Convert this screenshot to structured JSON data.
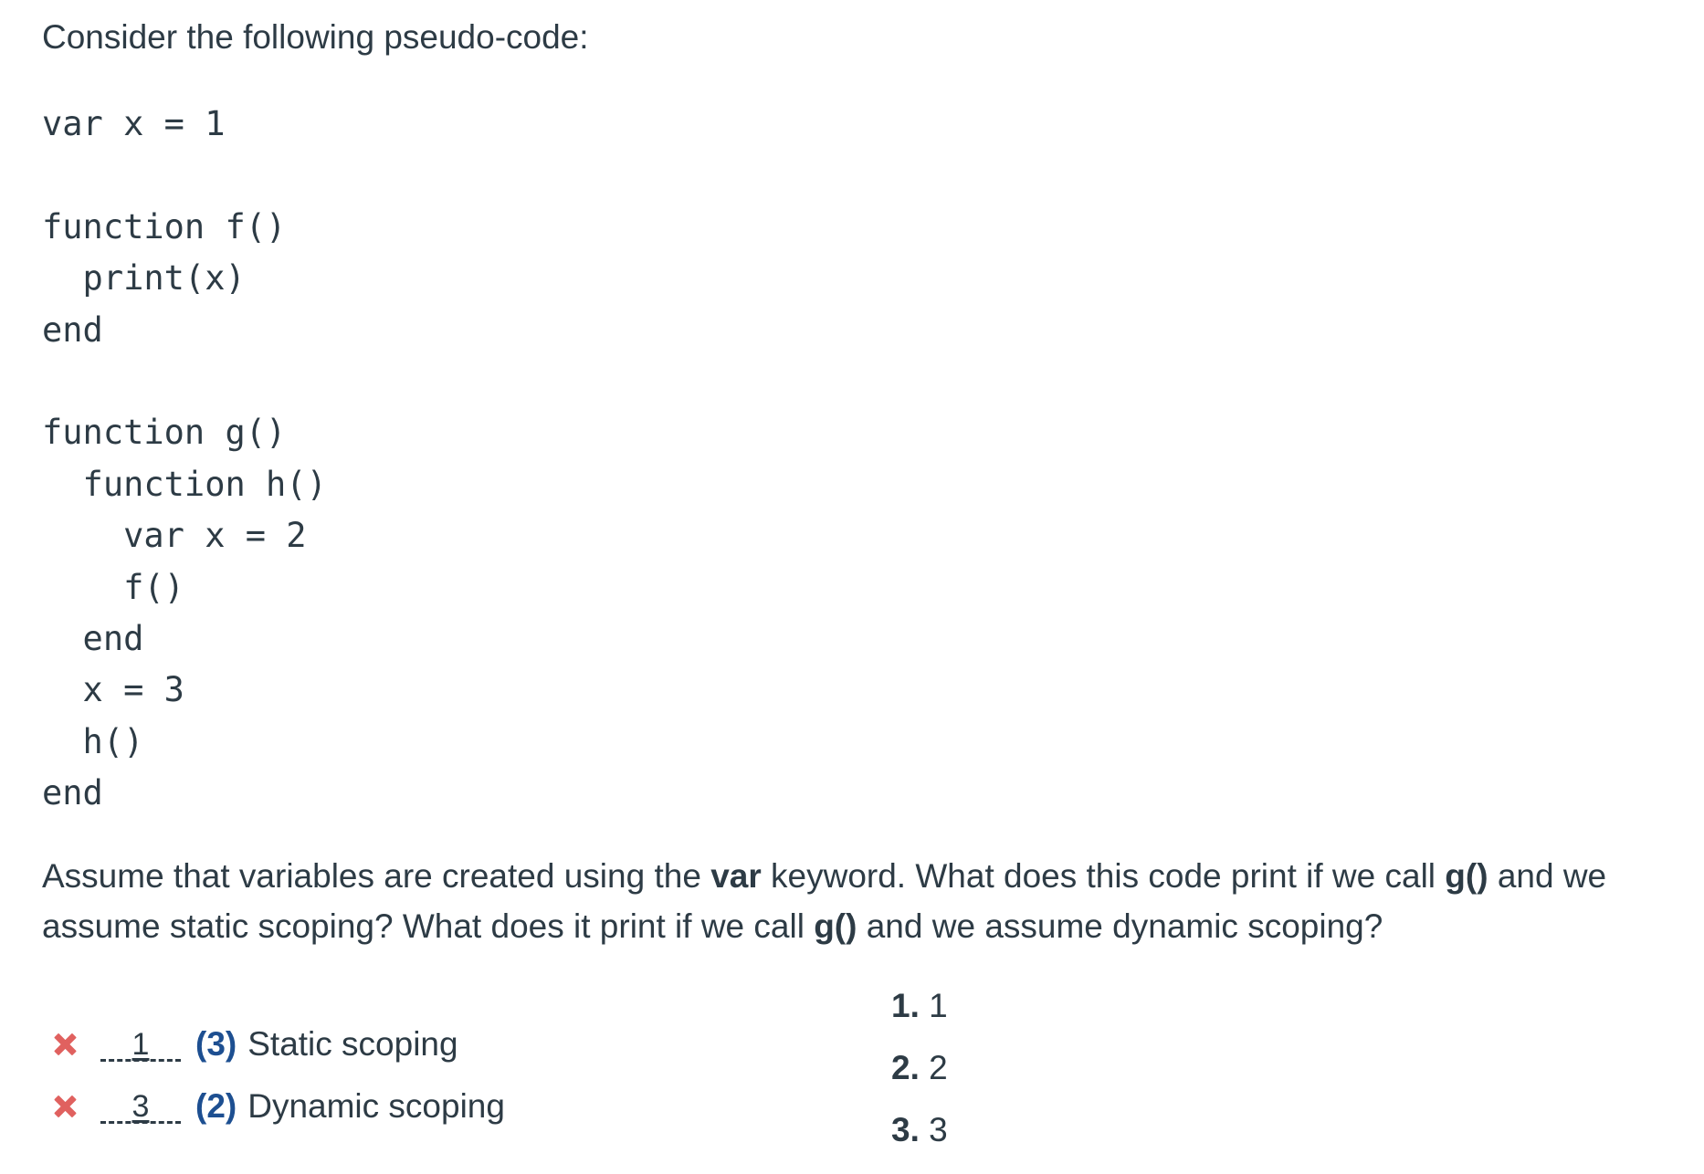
{
  "prompt": "Consider the following pseudo-code:",
  "code_lines": [
    "var x = 1",
    "",
    "function f()",
    "  print(x)",
    "end",
    "",
    "function g()",
    "  function h()",
    "    var x = 2",
    "    f()",
    "  end",
    "  x = 3",
    "  h()",
    "end"
  ],
  "question": {
    "part1": "Assume that variables are created using the ",
    "bold1": "var",
    "part2": " keyword.  What does this code print if we call ",
    "bold2": "g()",
    "part3": " and we",
    "part4": "assume static scoping?  What does it print if we call ",
    "bold3": "g()",
    "part5": " and we assume dynamic scoping?"
  },
  "answers": [
    {
      "given": "1",
      "correct_num": "(3)",
      "label": "Static scoping",
      "status": "incorrect"
    },
    {
      "given": "3",
      "correct_num": "(2)",
      "label": "Dynamic scoping",
      "status": "incorrect"
    }
  ],
  "options": [
    {
      "num": "1.",
      "value": "1"
    },
    {
      "num": "2.",
      "value": "2"
    },
    {
      "num": "3.",
      "value": "3"
    }
  ],
  "colors": {
    "text": "#2d3b45",
    "incorrect_mark": "#e0615f",
    "correct_answer": "#1d4f91"
  }
}
